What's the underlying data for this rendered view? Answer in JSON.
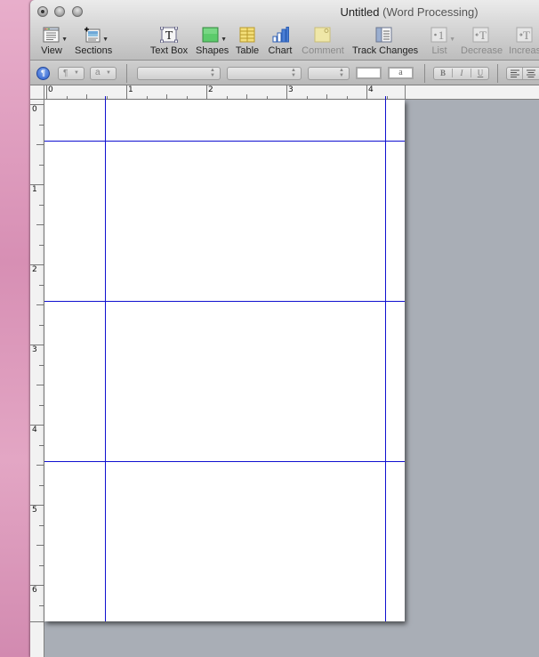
{
  "window": {
    "title": "Untitled",
    "subtitle": "(Word Processing)"
  },
  "toolbar": {
    "items": [
      {
        "id": "view",
        "label": "View",
        "icon": "view-icon",
        "has_dropdown": true,
        "enabled": true
      },
      {
        "id": "sections",
        "label": "Sections",
        "icon": "sections-icon",
        "has_dropdown": true,
        "enabled": true
      },
      {
        "id": "textbox",
        "label": "Text Box",
        "icon": "text-box-icon",
        "has_dropdown": false,
        "enabled": true
      },
      {
        "id": "shapes",
        "label": "Shapes",
        "icon": "shapes-icon",
        "has_dropdown": true,
        "enabled": true
      },
      {
        "id": "table",
        "label": "Table",
        "icon": "table-icon",
        "has_dropdown": false,
        "enabled": true
      },
      {
        "id": "chart",
        "label": "Chart",
        "icon": "chart-icon",
        "has_dropdown": false,
        "enabled": true
      },
      {
        "id": "comment",
        "label": "Comment",
        "icon": "comment-icon",
        "has_dropdown": false,
        "enabled": false
      },
      {
        "id": "trackchanges",
        "label": "Track Changes",
        "icon": "track-changes-icon",
        "has_dropdown": false,
        "enabled": true
      },
      {
        "id": "list",
        "label": "List",
        "icon": "list-icon",
        "has_dropdown": true,
        "enabled": false
      },
      {
        "id": "decrease",
        "label": "Decrease",
        "icon": "decrease-indent-icon",
        "has_dropdown": false,
        "enabled": false
      },
      {
        "id": "increase",
        "label": "Increas",
        "icon": "increase-indent-icon",
        "has_dropdown": false,
        "enabled": false
      }
    ]
  },
  "formatbar": {
    "styles_drawer_glyph": "¶",
    "paragraph_style_glyph": "¶",
    "character_style_glyph": "a",
    "font_family_value": "",
    "font_typeface_value": "",
    "font_size_value": "",
    "text_color_value": "",
    "highlight_glyph": "a",
    "bold_label": "B",
    "italic_label": "I",
    "underline_label": "U"
  },
  "ruler": {
    "horizontal_labels": [
      "0",
      "1",
      "2",
      "3",
      "4"
    ],
    "vertical_labels": [
      "0",
      "1",
      "2",
      "3",
      "4",
      "5",
      "6"
    ],
    "unit": "inches"
  },
  "colors": {
    "layout_guide": "#1010d0",
    "canvas_bg": "#a9aeb6",
    "page_bg": "#ffffff"
  }
}
